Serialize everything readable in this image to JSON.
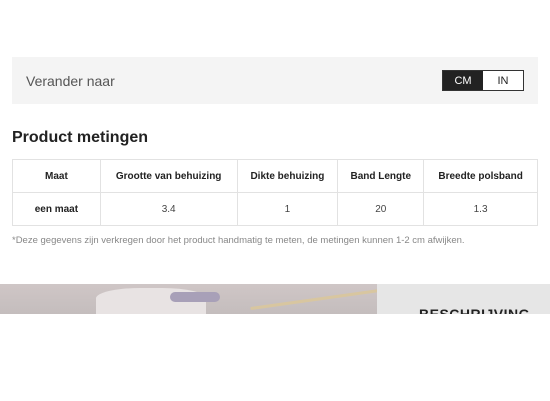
{
  "units": {
    "label": "Verander naar",
    "options": [
      "CM",
      "IN"
    ],
    "selected": "CM"
  },
  "measurements": {
    "title": "Product metingen",
    "headers": [
      "Maat",
      "Grootte van behuizing",
      "Dikte behuizing",
      "Band Lengte",
      "Breedte polsband"
    ],
    "rows": [
      [
        "een maat",
        "3.4",
        "1",
        "20",
        "1.3"
      ]
    ],
    "note": "*Deze gegevens zijn verkregen door het product handmatig te meten, de metingen kunnen 1-2 cm afwijken."
  },
  "description": {
    "title": "BESCHRIJVING"
  },
  "colors": {
    "toggle_active_bg": "#222222",
    "bar_bg": "#f4f4f4"
  }
}
